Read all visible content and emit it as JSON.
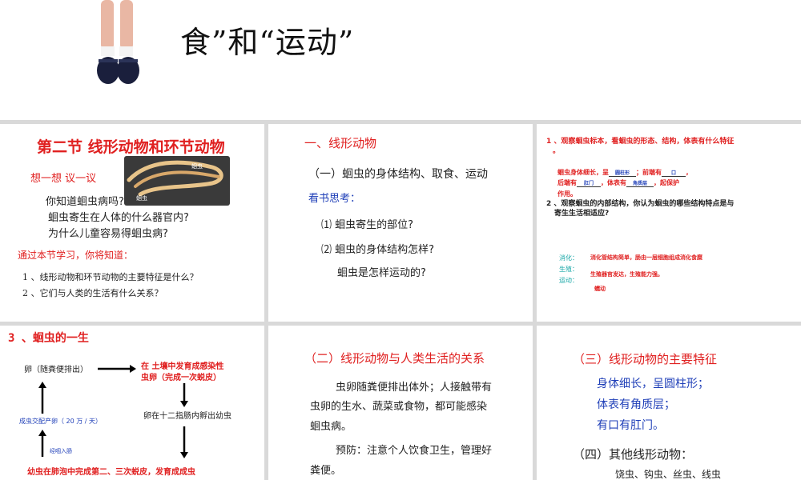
{
  "header": {
    "title": "食”和“运动”"
  },
  "slide1": {
    "title": "第二节 线形动物和环节动物",
    "subtitle": "想一想    议一议",
    "image_labels": [
      "蛔虫",
      "蛔虫"
    ],
    "questions": [
      "你知道蛔虫病吗?",
      "蛔虫寄生在人体的什么器官内?",
      "为什么儿童容易得蛔虫病?"
    ],
    "intro": "通过本节学习，你将知道：",
    "points": [
      "1 、线形动物和环节动物的主要特征是什么？",
      "2 、它们与人类的生活有什么关系？"
    ]
  },
  "slide2": {
    "heading": "一、线形动物",
    "sub": "（一）蛔虫的身体结构、取食、运动",
    "prompt": "看书思考：",
    "items": [
      "⑴ 蛔虫寄生的部位?",
      "⑵ 蛔虫的身体结构怎样?",
      "蛔虫是怎样运动的?"
    ]
  },
  "slide3": {
    "q1": "1 、观察蛔虫标本，看蛔虫的形态、结构，体表有什么特征",
    "q1_tail": "。",
    "f_line1_a": "蛔虫身体细长，呈",
    "f_blank1": "圆柱形",
    "f_line1_b": "；前端有",
    "f_blank2": "口",
    "f_line1_c": "，",
    "f_line2_a": "后端有",
    "f_blank3": "肛门",
    "f_line2_b": "，体表有",
    "f_blank4": "角质层",
    "f_line2_c": "，起保护",
    "f_line3": "作用。",
    "q2a": "2 、观察蛔虫的内部结构，你认为蛔虫的哪些结构特点是与",
    "q2b": "寄生生活相适应?",
    "labels": [
      "消化：",
      "生殖：",
      "运动："
    ],
    "answers": [
      "消化管结构简单，肠由一层细胞组成消化食糜",
      "生殖器官发达，生殖能力强。",
      "蠕动"
    ]
  },
  "slide4": {
    "title": "3 、蛔虫的一生",
    "egg": "卵（随粪便排出）",
    "soil1": "在  土壤中发育成感染性",
    "soil2": "虫卵（完成一次蜕皮）",
    "hatch": "卵在十二指肠内孵出幼虫",
    "adult": "成虫交配产卵（ 20 万 / 天）",
    "swallow": "经咽入肠",
    "lung": "幼虫在肺泡中完成第二、三次蜕皮，发育成成虫"
  },
  "slide5": {
    "heading": "（二）线形动物与人类生活的关系",
    "p1_l1": "虫卵随粪便排出体外；人接触带有",
    "p1_l2": "虫卵的生水、蔬菜或食物，都可能感染",
    "p1_l3": "蛔虫病。",
    "p2_l1": "预防：注意个人饮食卫生，管理好",
    "p2_l2": "粪便。"
  },
  "slide6": {
    "heading": "（三）线形动物的主要特征",
    "features": [
      "身体细长，呈圆柱形；",
      "体表有角质层；",
      "有口有肛门。"
    ],
    "others_heading": "（四）其他线形动物：",
    "others": "饶虫、钩虫、丝虫、线虫"
  }
}
